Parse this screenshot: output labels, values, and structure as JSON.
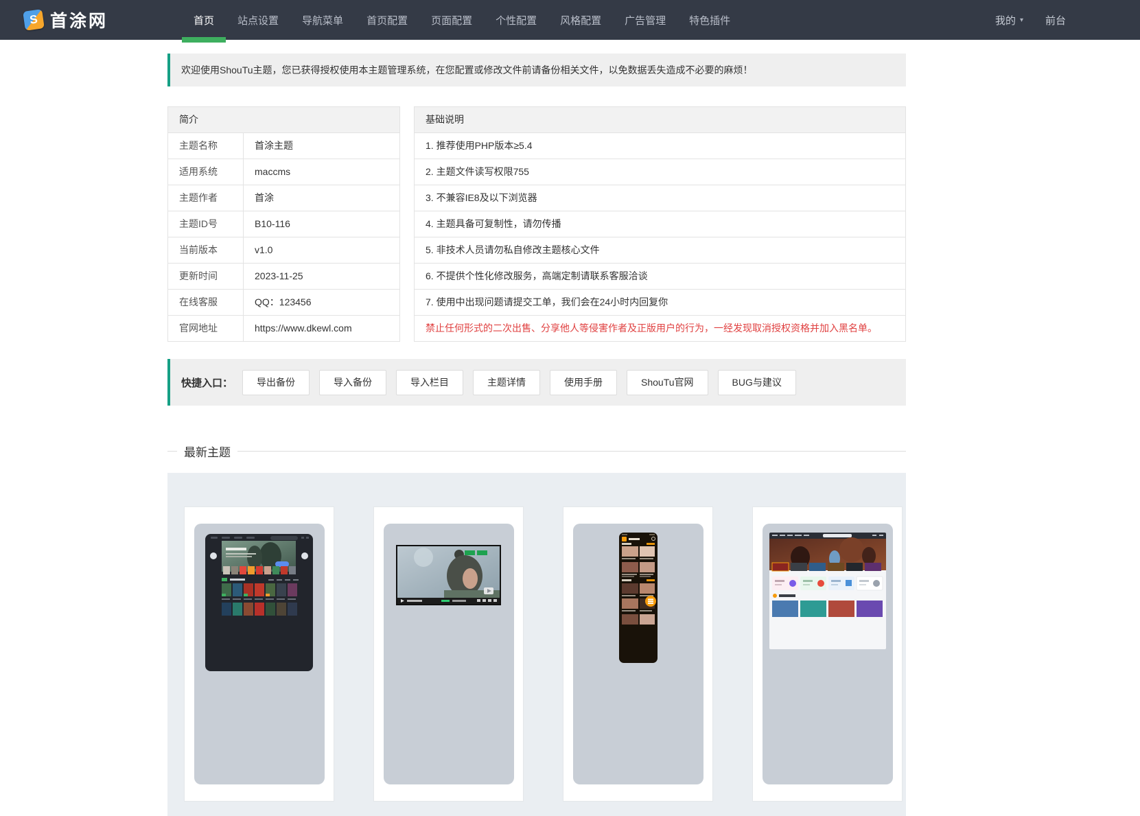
{
  "colors": {
    "navbar_bg": "#343a46",
    "accent_green": "#3eaf5f",
    "teal_border": "#16a085",
    "warning_red": "#e04040"
  },
  "icons": {
    "caret_down": "▾",
    "logo_monogram": "S"
  },
  "navbar": {
    "logo_text": "首涂网",
    "items": [
      {
        "label": "首页",
        "active": true
      },
      {
        "label": "站点设置",
        "active": false
      },
      {
        "label": "导航菜单",
        "active": false
      },
      {
        "label": "首页配置",
        "active": false
      },
      {
        "label": "页面配置",
        "active": false
      },
      {
        "label": "个性配置",
        "active": false
      },
      {
        "label": "风格配置",
        "active": false
      },
      {
        "label": "广告管理",
        "active": false
      },
      {
        "label": "特色插件",
        "active": false
      }
    ],
    "right": {
      "my": "我的",
      "front": "前台"
    }
  },
  "banner": {
    "text": "欢迎使用ShouTu主题，您已获得授权使用本主题管理系统，在您配置或修改文件前请备份相关文件，以免数据丢失造成不必要的麻烦！"
  },
  "intro": {
    "title": "简介",
    "rows": [
      {
        "label": "主题名称",
        "value": "首涂主题"
      },
      {
        "label": "适用系统",
        "value": "maccms"
      },
      {
        "label": "主题作者",
        "value": "首涂"
      },
      {
        "label": "主题ID号",
        "value": "B10-116"
      },
      {
        "label": "当前版本",
        "value": "v1.0"
      },
      {
        "label": "更新时间",
        "value": "2023-11-25"
      },
      {
        "label": "在线客服",
        "value": "QQ：123456"
      },
      {
        "label": "官网地址",
        "value": "https://www.dkewl.com"
      }
    ]
  },
  "notes": {
    "title": "基础说明",
    "items": [
      "1. 推荐使用PHP版本≥5.4",
      "2. 主题文件读写权限755",
      "3. 不兼容IE8及以下浏览器",
      "4. 主题具备可复制性，请勿传播",
      "5. 非技术人员请勿私自修改主题核心文件",
      "6. 不提供个性化修改服务，高端定制请联系客服洽谈",
      "7. 使用中出现问题请提交工单，我们会在24小时内回复你"
    ],
    "warning": "禁止任何形式的二次出售、分享他人等侵害作者及正版用户的行为，一经发现取消授权资格并加入黑名单。"
  },
  "quick_entry": {
    "label": "快捷入口：",
    "buttons": [
      "导出备份",
      "导入备份",
      "导入栏目",
      "主题详情",
      "使用手册",
      "ShouTu官网",
      "BUG与建议"
    ]
  },
  "latest": {
    "title": "最新主题",
    "card_count": 4
  }
}
